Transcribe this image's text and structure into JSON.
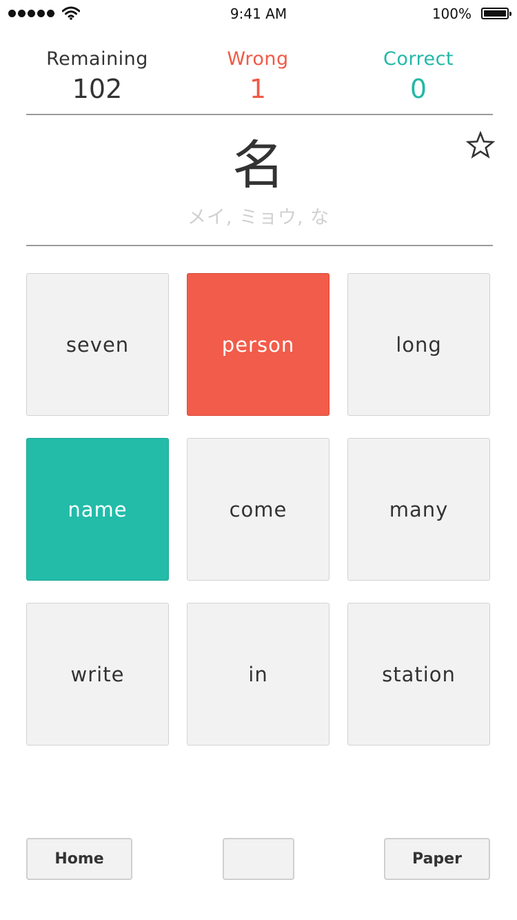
{
  "status_bar": {
    "time": "9:41 AM",
    "battery_percent": "100%",
    "battery_level": 1.0,
    "signal_bars": 5,
    "icons": [
      "signal-dots-icon",
      "wifi-icon",
      "battery-icon"
    ]
  },
  "stats": {
    "remaining": {
      "label": "Remaining",
      "value": "102"
    },
    "wrong": {
      "label": "Wrong",
      "value": "1"
    },
    "correct": {
      "label": "Correct",
      "value": "0"
    }
  },
  "question": {
    "kanji": "名",
    "reading": "メイ, ミョウ, な",
    "favorite_icon": "star-outline-icon"
  },
  "answers": [
    {
      "label": "seven",
      "state": "normal"
    },
    {
      "label": "person",
      "state": "wrong"
    },
    {
      "label": "long",
      "state": "normal"
    },
    {
      "label": "name",
      "state": "correct"
    },
    {
      "label": "come",
      "state": "normal"
    },
    {
      "label": "many",
      "state": "normal"
    },
    {
      "label": "write",
      "state": "normal"
    },
    {
      "label": "in",
      "state": "normal"
    },
    {
      "label": "station",
      "state": "normal"
    }
  ],
  "buttons": {
    "home": "Home",
    "middle": "",
    "paper": "Paper"
  },
  "colors": {
    "wrong": "#f25c4a",
    "correct": "#22bca9",
    "wrong_text": "#f05a46",
    "correct_text": "#22b8a6",
    "tile_background": "#f2f2f3",
    "reading_text": "#d0d0d0"
  }
}
